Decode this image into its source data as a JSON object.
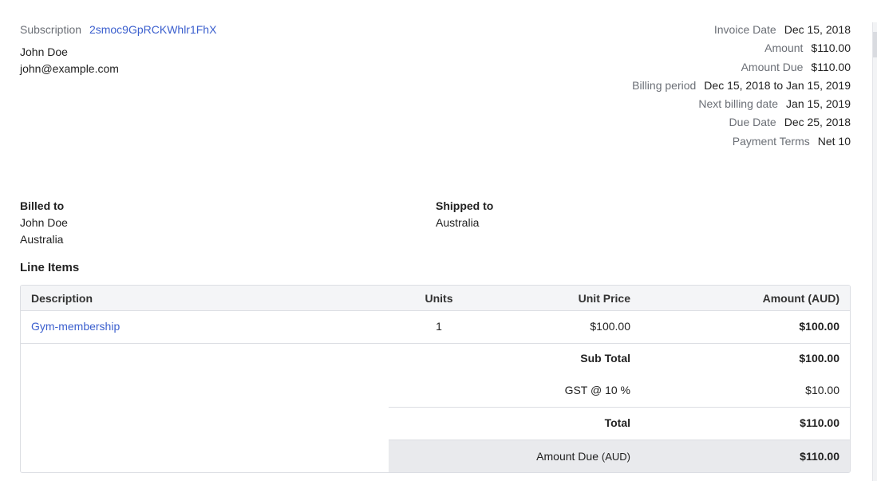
{
  "subscription": {
    "label": "Subscription",
    "id": "2smoc9GpRCKWhlr1FhX"
  },
  "customer": {
    "name": "John Doe",
    "email": "john@example.com"
  },
  "meta": [
    {
      "key": "Invoice Date",
      "value": "Dec 15, 2018"
    },
    {
      "key": "Amount",
      "value": "$110.00"
    },
    {
      "key": "Amount Due",
      "value": "$110.00"
    },
    {
      "key": "Billing period",
      "value": "Dec 15, 2018 to Jan 15, 2019"
    },
    {
      "key": "Next billing date",
      "value": "Jan 15, 2019"
    },
    {
      "key": "Due Date",
      "value": "Dec 25, 2018"
    },
    {
      "key": "Payment Terms",
      "value": "Net 10"
    }
  ],
  "billed_to": {
    "title": "Billed to",
    "name": "John Doe",
    "country": "Australia"
  },
  "shipped_to": {
    "title": "Shipped to",
    "country": "Australia"
  },
  "line_items": {
    "title": "Line Items",
    "headers": {
      "description": "Description",
      "units": "Units",
      "unit_price": "Unit Price",
      "amount": "Amount (AUD)"
    },
    "rows": [
      {
        "description": "Gym-membership",
        "units": "1",
        "unit_price": "$100.00",
        "amount": "$100.00"
      }
    ],
    "summary": {
      "sub_total_label": "Sub Total",
      "sub_total": "$100.00",
      "tax_label": "GST @ 10 %",
      "tax": "$10.00",
      "total_label": "Total",
      "total": "$110.00",
      "amount_due_label": "Amount Due",
      "amount_due_currency": "(AUD)",
      "amount_due": "$110.00"
    }
  },
  "colors": {
    "link": "#3b5fce",
    "muted": "#6b6f76",
    "header_bg": "#f4f5f7",
    "due_bg": "#e9eaed"
  }
}
